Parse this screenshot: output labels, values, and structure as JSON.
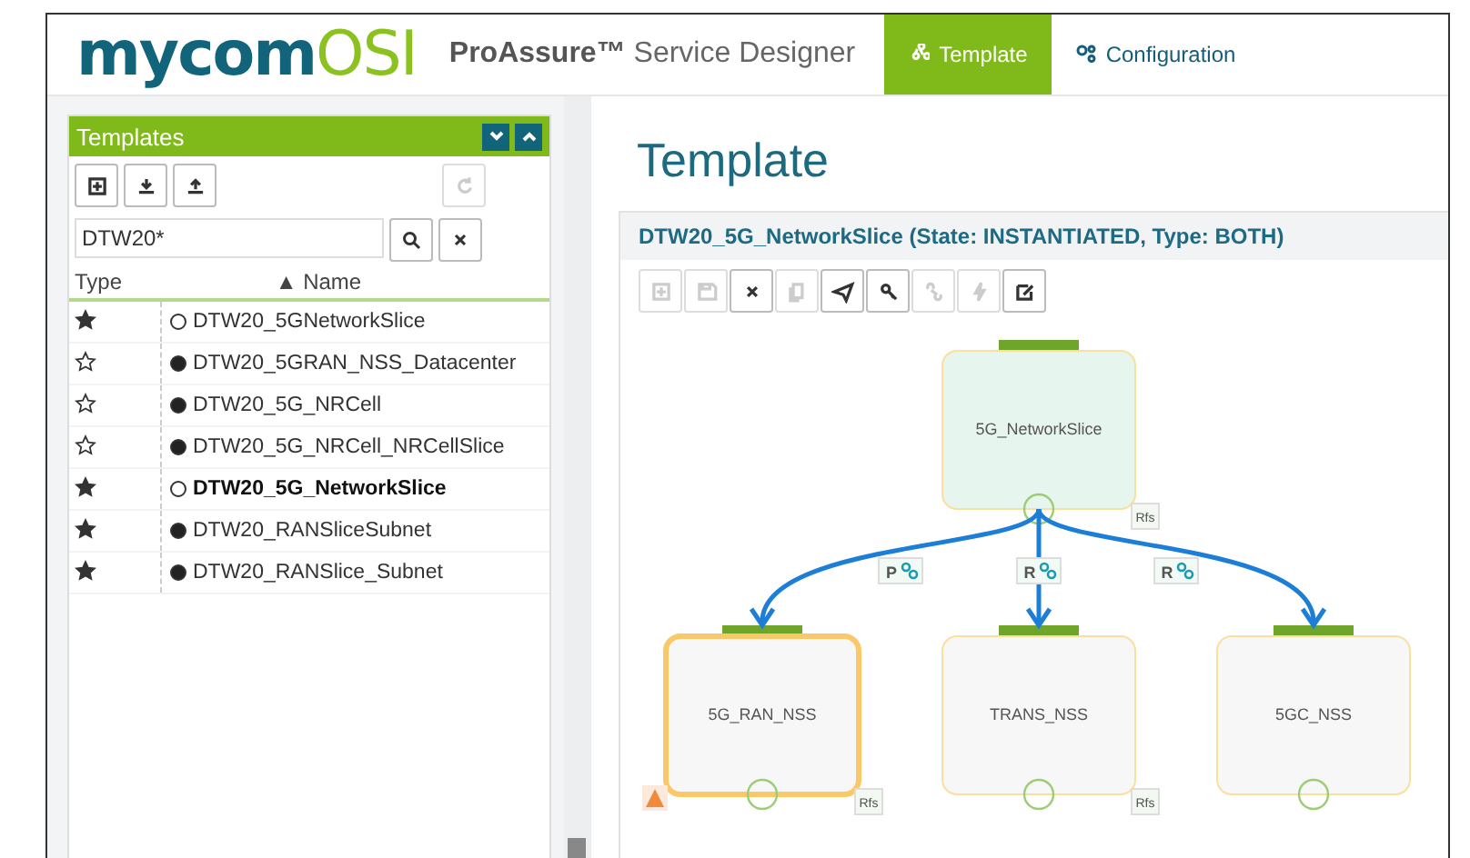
{
  "header": {
    "logo": {
      "primary": "mycom",
      "secondary": "OSI"
    },
    "product": {
      "brand": "ProAssure™",
      "subtitle": "Service Designer"
    },
    "nav": [
      {
        "label": "Template",
        "selected": true
      },
      {
        "label": "Configuration",
        "selected": false
      }
    ]
  },
  "templates_panel": {
    "title": "Templates",
    "toolbar": [
      {
        "disabled": false
      },
      {
        "disabled": false
      },
      {
        "disabled": false
      },
      {
        "disabled": true
      }
    ],
    "search": {
      "value": "DTW20*"
    },
    "columns": [
      {
        "label": "Type"
      },
      {
        "label": "Name",
        "sort": "▲"
      }
    ],
    "rows": [
      {
        "name": "DTW20_5GNetworkSlice",
        "starred": true,
        "instantiated": false,
        "selected": false
      },
      {
        "name": "DTW20_5GRAN_NSS_Datacenter",
        "starred": false,
        "instantiated": true,
        "selected": false
      },
      {
        "name": "DTW20_5G_NRCell",
        "starred": false,
        "instantiated": true,
        "selected": false
      },
      {
        "name": "DTW20_5G_NRCell_NRCellSlice",
        "starred": false,
        "instantiated": true,
        "selected": false
      },
      {
        "name": "DTW20_5G_NetworkSlice",
        "starred": true,
        "instantiated": false,
        "selected": true
      },
      {
        "name": "DTW20_RANSliceSubnet",
        "starred": true,
        "instantiated": true,
        "selected": false
      },
      {
        "name": "DTW20_RANSlice_Subnet",
        "starred": true,
        "instantiated": true,
        "selected": false
      }
    ]
  },
  "page_title": "Template",
  "template_card": {
    "title": "DTW20_5G_NetworkSlice (State: INSTANTIATED, Type: BOTH)",
    "toolbar": [
      {
        "disabled": true
      },
      {
        "disabled": true
      },
      {
        "disabled": false
      },
      {
        "disabled": true
      },
      {
        "disabled": false
      },
      {
        "disabled": false
      },
      {
        "disabled": true
      },
      {
        "disabled": true
      },
      {
        "disabled": false
      }
    ],
    "diagram": {
      "root": {
        "name": "5G_NetworkSlice",
        "tag": "Rfs",
        "highlighted": true,
        "selected": false,
        "warning": false
      },
      "children": [
        {
          "relation": "P",
          "name": "5G_RAN_NSS",
          "tag": "Rfs",
          "highlighted": false,
          "selected": true,
          "warning": true
        },
        {
          "relation": "R",
          "name": "TRANS_NSS",
          "tag": "Rfs",
          "highlighted": false,
          "selected": false,
          "warning": false
        },
        {
          "relation": "R",
          "name": "5GC_NSS",
          "highlighted": false,
          "selected": false,
          "warning": false
        }
      ]
    }
  }
}
